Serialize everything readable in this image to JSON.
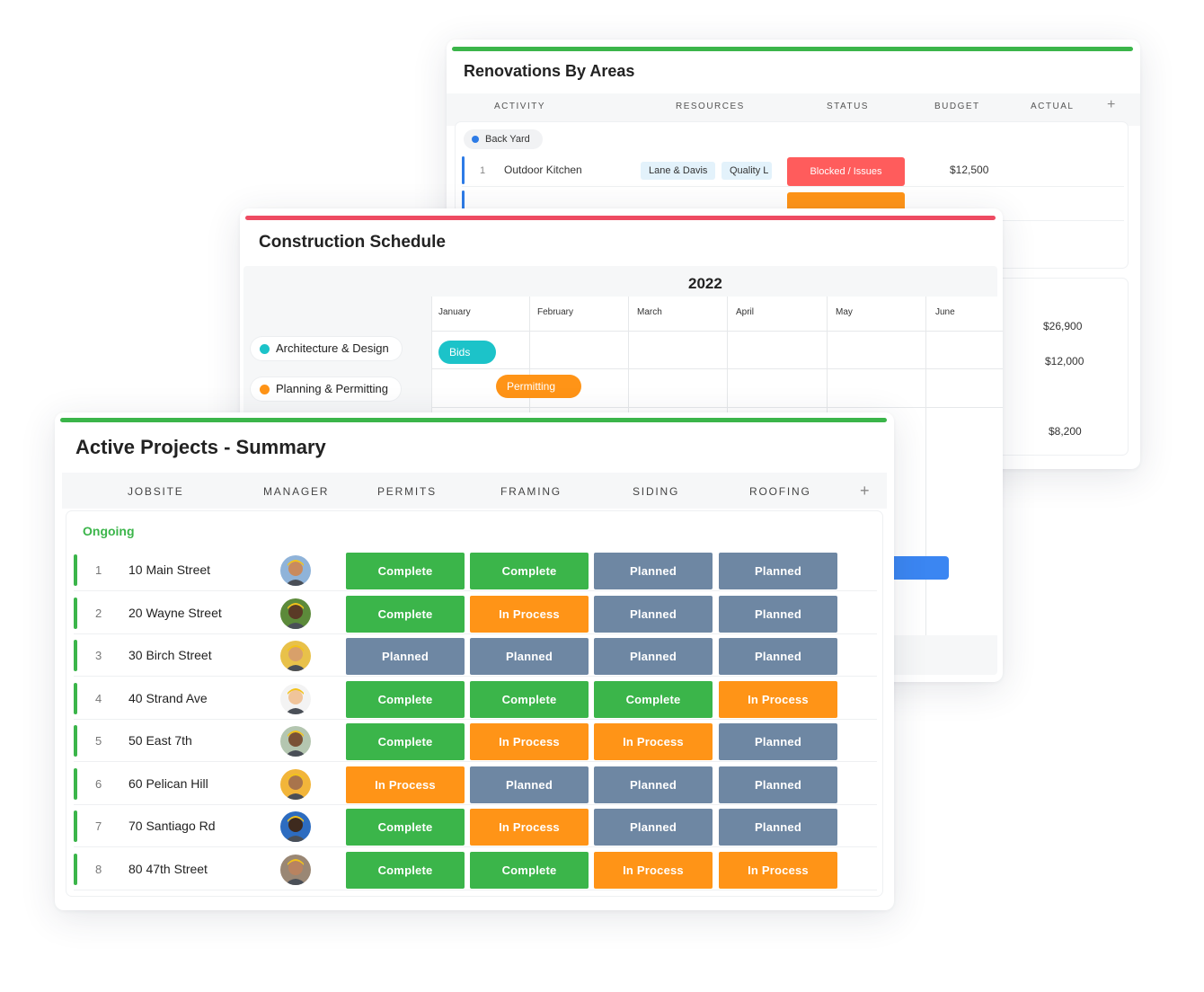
{
  "colors": {
    "complete": "#3bb54a",
    "in_process": "#ff9417",
    "planned": "#6e87a3",
    "blocked": "#ff5c5c",
    "accent_green": "#3bb54a",
    "accent_red": "#ee4b62",
    "accent_blue": "#2d7be6",
    "accent_teal": "#1cc3c9"
  },
  "renovations": {
    "title": "Renovations By Areas",
    "columns": [
      "ACTIVITY",
      "RESOURCES",
      "STATUS",
      "BUDGET",
      "ACTUAL"
    ],
    "add_icon": "+",
    "group": "Back Yard",
    "rows": [
      {
        "num": "1",
        "activity": "Outdoor Kitchen",
        "resources": [
          "Lane & Davis",
          "Quality L"
        ],
        "status": "Blocked / Issues",
        "budget": "$12,500"
      }
    ],
    "amounts": [
      "$26,900",
      "$12,000",
      "$8,200"
    ]
  },
  "schedule": {
    "title": "Construction Schedule",
    "year": "2022",
    "months": [
      "January",
      "February",
      "March",
      "April",
      "May",
      "June"
    ],
    "rows": [
      {
        "label": "Architecture & Design",
        "color": "#1cc3c9",
        "bar": "Bids"
      },
      {
        "label": "Planning & Permitting",
        "color": "#ff9417",
        "bar": "Permitting"
      }
    ]
  },
  "active": {
    "title": "Active Projects - Summary",
    "columns": [
      "JOBSITE",
      "MANAGER",
      "PERMITS",
      "FRAMING",
      "SIDING",
      "ROOFING"
    ],
    "add_icon": "+",
    "group": "Ongoing",
    "rows": [
      {
        "num": "1",
        "site": "10 Main Street",
        "permits": "Complete",
        "framing": "Complete",
        "siding": "Planned",
        "roofing": "Planned"
      },
      {
        "num": "2",
        "site": "20 Wayne Street",
        "permits": "Complete",
        "framing": "In Process",
        "siding": "Planned",
        "roofing": "Planned"
      },
      {
        "num": "3",
        "site": "30 Birch Street",
        "permits": "Planned",
        "framing": "Planned",
        "siding": "Planned",
        "roofing": "Planned"
      },
      {
        "num": "4",
        "site": "40 Strand Ave",
        "permits": "Complete",
        "framing": "Complete",
        "siding": "Complete",
        "roofing": "In Process"
      },
      {
        "num": "5",
        "site": "50 East 7th",
        "permits": "Complete",
        "framing": "In Process",
        "siding": "In Process",
        "roofing": "Planned"
      },
      {
        "num": "6",
        "site": "60 Pelican Hill",
        "permits": "In Process",
        "framing": "Planned",
        "siding": "Planned",
        "roofing": "Planned"
      },
      {
        "num": "7",
        "site": "70 Santiago Rd",
        "permits": "Complete",
        "framing": "In Process",
        "siding": "Planned",
        "roofing": "Planned"
      },
      {
        "num": "8",
        "site": "80 47th Street",
        "permits": "Complete",
        "framing": "Complete",
        "siding": "In Process",
        "roofing": "In Process"
      }
    ]
  }
}
